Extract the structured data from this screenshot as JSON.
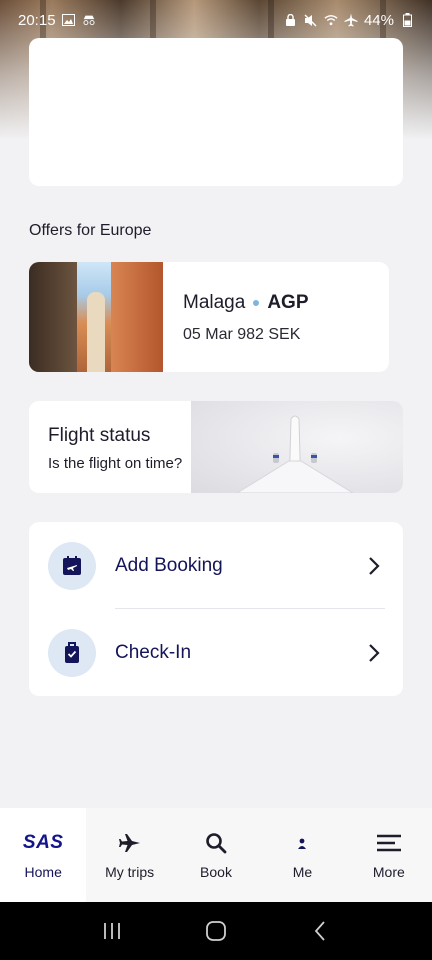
{
  "status_bar": {
    "time": "20:15",
    "battery": "44%",
    "icons": [
      "gallery-icon",
      "incognito-icon",
      "lock-icon",
      "mute-icon",
      "wifi-icon",
      "airplane-icon",
      "battery-icon"
    ]
  },
  "offers": {
    "section_title": "Offers for Europe",
    "items": [
      {
        "city": "Malaga",
        "code": "AGP",
        "details": "05 Mar 982 SEK"
      }
    ]
  },
  "flight_status": {
    "title": "Flight status",
    "subtitle": "Is the flight on time?"
  },
  "actions": [
    {
      "label": "Add Booking",
      "icon": "boarding-pass-icon"
    },
    {
      "label": "Check-In",
      "icon": "luggage-icon"
    }
  ],
  "bottom_nav": {
    "items": [
      {
        "label": "Home",
        "icon": "sas-logo",
        "logo_text": "SAS",
        "active": true
      },
      {
        "label": "My trips",
        "icon": "airplane-icon",
        "active": false
      },
      {
        "label": "Book",
        "icon": "search-icon",
        "active": false
      },
      {
        "label": "Me",
        "icon": "person-icon",
        "active": false
      },
      {
        "label": "More",
        "icon": "menu-icon",
        "active": false
      }
    ]
  },
  "colors": {
    "brand_navy": "#14145a",
    "logo_blue": "#14148c",
    "icon_circle": "#dde8f4",
    "background": "#f2f2f4",
    "accent_dot": "#7fb5dc"
  }
}
